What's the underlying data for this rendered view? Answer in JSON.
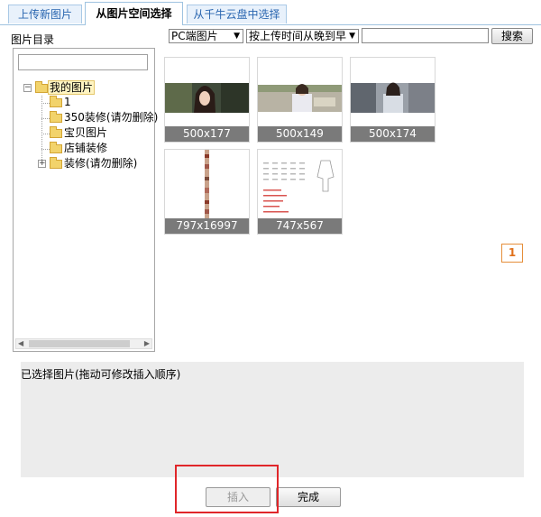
{
  "tabs": [
    {
      "label": "上传新图片",
      "active": false
    },
    {
      "label": "从图片空间选择",
      "active": true
    },
    {
      "label": "从千牛云盘中选择",
      "active": false
    }
  ],
  "sidebar": {
    "title": "图片目录",
    "search_value": "",
    "root": {
      "label": "我的图片",
      "expanded": true,
      "selected": true
    },
    "items": [
      {
        "label": "1",
        "expandable": false
      },
      {
        "label": "350装修(请勿删除)",
        "expandable": false
      },
      {
        "label": "宝贝图片",
        "expandable": false
      },
      {
        "label": "店铺装修",
        "expandable": false
      },
      {
        "label": "装修(请勿删除)",
        "expandable": true
      }
    ]
  },
  "toolbar": {
    "source_select": "PC端图片",
    "sort_select": "按上传时间从晚到早",
    "search_value": "",
    "search_button": "搜索"
  },
  "images": [
    {
      "dims": "500x177"
    },
    {
      "dims": "500x149"
    },
    {
      "dims": "500x174"
    },
    {
      "dims": "797x16997"
    },
    {
      "dims": "747x567"
    }
  ],
  "pagination": {
    "current": "1"
  },
  "selected_section": {
    "label": "已选择图片(拖动可修改插入顺序)"
  },
  "buttons": {
    "insert": "插入",
    "done": "完成"
  },
  "colors": {
    "tab_accent": "#2a66b0",
    "pager": "#e0701a",
    "highlight": "#e0262a"
  }
}
